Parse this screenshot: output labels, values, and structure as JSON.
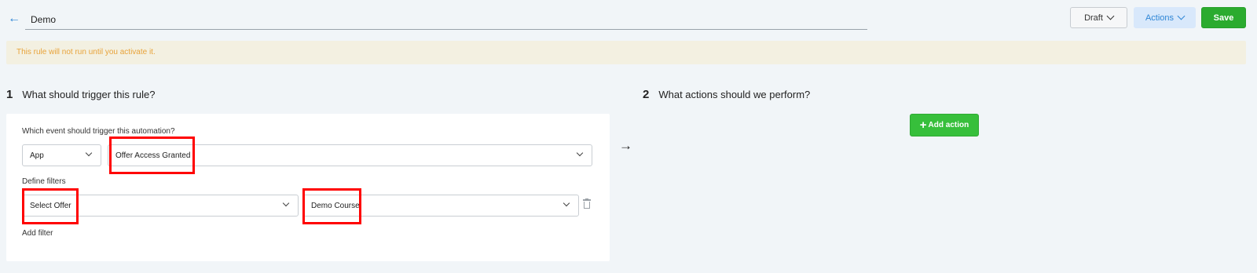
{
  "header": {
    "back_icon": "arrow-left-icon",
    "title_value": "Demo",
    "status_label": "Draft",
    "actions_label": "Actions",
    "save_label": "Save",
    "accent_color": "#2f86d6",
    "save_color": "#2bab2f"
  },
  "alert": {
    "text": "This rule will not run until you activate it."
  },
  "trigger_section": {
    "number": "1",
    "heading": "What should trigger this rule?",
    "event_label": "Which event should trigger this automation?",
    "source_value": "App",
    "event_value": "Offer Access Granted",
    "filters_label": "Define filters",
    "filter_field_value": "Select Offer",
    "filter_value": "Demo Course",
    "add_filter_label": "Add filter"
  },
  "actions_section": {
    "number": "2",
    "heading": "What actions should we perform?",
    "add_action_label": "Add action",
    "add_action_color": "#37bf3b"
  },
  "annotations": {
    "highlight_color": "#ff0000"
  }
}
